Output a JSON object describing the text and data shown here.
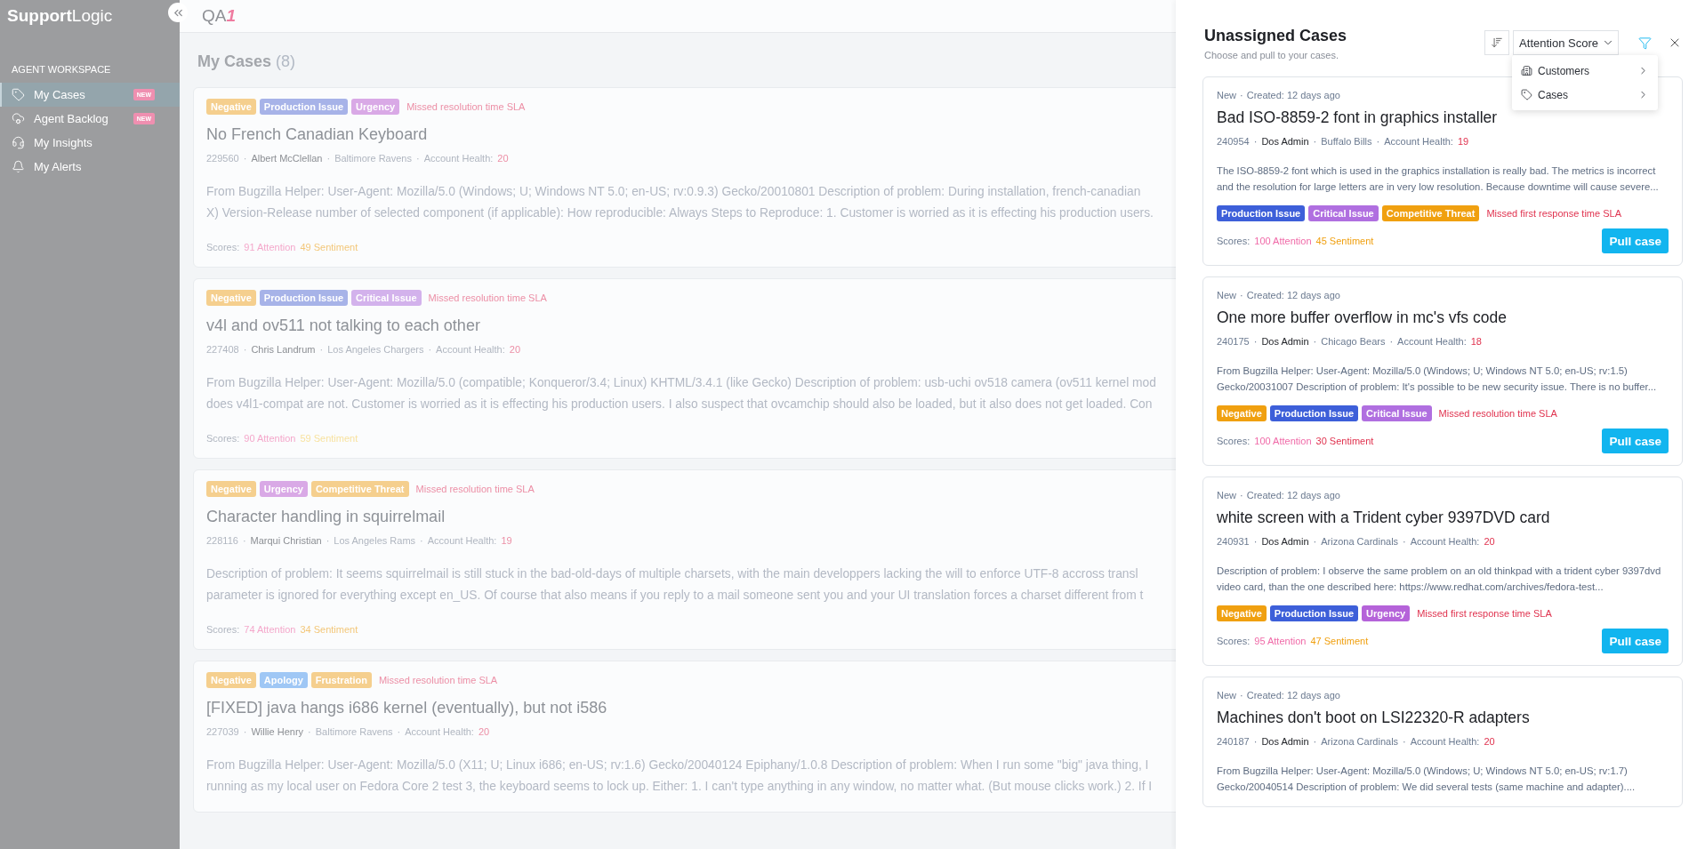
{
  "sidebar": {
    "logo": "**Support**Logic",
    "section_title": "AGENT WORKSPACE",
    "items": [
      {
        "label": "My Cases",
        "selected": true,
        "badge": "NEW"
      },
      {
        "label": "Agent Backlog",
        "selected": false,
        "badge": "NEW"
      },
      {
        "label": "My Insights",
        "selected": false
      },
      {
        "label": "My Alerts",
        "selected": false
      }
    ]
  },
  "header": {
    "workspace": "QA",
    "workspace_suffix": "1"
  },
  "main": {
    "title": "My Cases",
    "count": "(8)",
    "cases": [
      {
        "tags": [
          {
            "label": "Negative",
            "color": "#f5cf8e"
          },
          {
            "label": "Production Issue",
            "color": "#a7b3e8"
          },
          {
            "label": "Urgency",
            "color": "#d9a9e6"
          }
        ],
        "sla": "Missed resolution time SLA",
        "title": "No French Canadian Keyboard",
        "meta": [
          "229560",
          "·",
          "Albert McClellan",
          "·",
          "Baltimore Ravens",
          "·",
          "Account Health:",
          "20"
        ],
        "description_lines": [
          "From Bugzilla Helper: User-Agent: Mozilla/5.0 (Windows; U; Windows NT 5.0; en-US; rv:0.9.3) Gecko/20010801 Description of problem: During installation, french-canadian",
          "X) Version-Release number of selected component (if applicable): How reproducible: Always Steps to Reproduce: 1. Customer is worried as it is effecting his production users."
        ],
        "scores_label": "Scores:",
        "attention": "91 Attention",
        "sentiment": {
          "text": "49 Sentiment",
          "color": "#f3c77a"
        }
      },
      {
        "tags": [
          {
            "label": "Negative",
            "color": "#f5cf8e"
          },
          {
            "label": "Production Issue",
            "color": "#a7b3e8"
          },
          {
            "label": "Critical Issue",
            "color": "#d3b2ec"
          }
        ],
        "sla": "Missed resolution time SLA",
        "title": "v4l and ov511 not talking to each other",
        "meta": [
          "227408",
          "·",
          "Chris Landrum",
          "·",
          "Los Angeles Chargers",
          "·",
          "Account Health:",
          "20"
        ],
        "description_lines": [
          "From Bugzilla Helper: User-Agent: Mozilla/5.0 (compatible; Konqueror/3.4; Linux) KHTML/3.4.1 (like Gecko) Description of problem: usb-uchi ov518 camera (ov511 kernel mod",
          "does v4l1-compat are not. Customer is worried as it is effecting his production users. I also suspect that ovcamchip should also be loaded, but it also does not get loaded. Con"
        ],
        "scores_label": "Scores:",
        "attention": "90 Attention",
        "sentiment": {
          "text": "59 Sentiment",
          "color": "#f8e2a0"
        }
      },
      {
        "tags": [
          {
            "label": "Negative",
            "color": "#f5cf8e"
          },
          {
            "label": "Urgency",
            "color": "#d9a9e6"
          },
          {
            "label": "Competitive Threat",
            "color": "#f5cf8e"
          }
        ],
        "sla": "Missed resolution time SLA",
        "title": "Character handling in squirrelmail",
        "meta": [
          "228116",
          "·",
          "Marqui Christian",
          "·",
          "Los Angeles Rams",
          "·",
          "Account Health:",
          "19"
        ],
        "description_lines": [
          "Description of problem: It seems squirrelmail is still stuck in the bad-old-days of multiple charsets, with the main developpers lacking the will to enforce UTF-8 accross transl",
          "parameter is ignored for everything except en_US. Of course that also means if you reply to a mail someone sent you and your UI translation forces a charset different from t"
        ],
        "scores_label": "Scores:",
        "attention": "74 Attention",
        "sentiment": {
          "text": "34 Sentiment",
          "color": "#f3c77a"
        }
      },
      {
        "tags": [
          {
            "label": "Negative",
            "color": "#f5cf8e"
          },
          {
            "label": "Apology",
            "color": "#9fc7f5"
          },
          {
            "label": "Frustration",
            "color": "#f5cf8e"
          }
        ],
        "sla": "Missed resolution time SLA",
        "title": "[FIXED] java hangs i686 kernel (eventually), but not i586",
        "meta": [
          "227039",
          "·",
          "Willie Henry",
          "·",
          "Baltimore Ravens",
          "·",
          "Account Health:",
          "20"
        ],
        "description_lines": [
          "From Bugzilla Helper: User-Agent: Mozilla/5.0 (X11; U; Linux i686; en-US; rv:1.6) Gecko/20040124 Epiphany/1.0.8 Description of problem: When I run some \"big\" java thing, I",
          "running as my local user on Fedora Core 2 test 3, the keyboard seems to lock up. Either: 1. I can't type anything in any window, no matter what. (But mouse clicks work.) 2. If I"
        ]
      }
    ]
  },
  "panel": {
    "title": "Unassigned Cases",
    "subtitle": "Choose and pull to your cases.",
    "sort_field": "Attention Score",
    "menu": [
      {
        "label": "Customers"
      },
      {
        "label": "Cases"
      }
    ],
    "cards": [
      {
        "status": [
          "New",
          "·",
          "Created: 12 days ago"
        ],
        "title": "Bad ISO-8859-2 font in graphics installer",
        "meta": [
          "240954",
          "·",
          "Dos Admin",
          "·",
          "Buffalo Bills",
          "·",
          "Account Health:",
          "19"
        ],
        "description": "The ISO-8859-2 font which is used in the graphics installation is really bad. The metrics is incorrect and the resolution for large letters are in very low resolution. Because downtime will cause severe...",
        "tags": [
          {
            "label": "Production Issue",
            "color": "#3d5fd9"
          },
          {
            "label": "Critical Issue",
            "color": "#b06fe0"
          },
          {
            "label": "Competitive Threat",
            "color": "#f0a010"
          }
        ],
        "sla": "Missed first response time SLA",
        "scores_label": "Scores:",
        "attention": "100 Attention",
        "sentiment": {
          "text": "45 Sentiment",
          "color": "#f0a010"
        },
        "button": "Pull case"
      },
      {
        "status": [
          "New",
          "·",
          "Created: 12 days ago"
        ],
        "title": "One more buffer overflow in mc's vfs code",
        "meta": [
          "240175",
          "·",
          "Dos Admin",
          "·",
          "Chicago Bears",
          "·",
          "Account Health:",
          "18"
        ],
        "description": "From Bugzilla Helper: User-Agent: Mozilla/5.0 (Windows; U; Windows NT 5.0; en-US; rv:1.5) Gecko/20031007 Description of problem: It's possible to be new security issue. There is no buffer...",
        "tags": [
          {
            "label": "Negative",
            "color": "#f0a010"
          },
          {
            "label": "Production Issue",
            "color": "#3d5fd9"
          },
          {
            "label": "Critical Issue",
            "color": "#b06fe0"
          }
        ],
        "sla": "Missed resolution time SLA",
        "scores_label": "Scores:",
        "attention": "100 Attention",
        "sentiment": {
          "text": "30 Sentiment",
          "color": "#e0334f"
        },
        "button": "Pull case"
      },
      {
        "status": [
          "New",
          "·",
          "Created: 12 days ago"
        ],
        "title": "white screen with a Trident cyber 9397DVD card",
        "meta": [
          "240931",
          "·",
          "Dos Admin",
          "·",
          "Arizona Cardinals",
          "·",
          "Account Health:",
          "20"
        ],
        "description": "Description of problem: I observe the same problem on an old thinkpad with a trident cyber 9397dvd video card, than the one described here: https://www.redhat.com/archives/fedora-test...",
        "tags": [
          {
            "label": "Negative",
            "color": "#f0a010"
          },
          {
            "label": "Production Issue",
            "color": "#3d5fd9"
          },
          {
            "label": "Urgency",
            "color": "#b563d9"
          }
        ],
        "sla": "Missed first response time SLA",
        "scores_label": "Scores:",
        "attention": "95 Attention",
        "sentiment": {
          "text": "47 Sentiment",
          "color": "#f0a010"
        },
        "button": "Pull case"
      },
      {
        "status": [
          "New",
          "·",
          "Created: 12 days ago"
        ],
        "title": "Machines don't boot on LSI22320-R adapters",
        "meta": [
          "240187",
          "·",
          "Dos Admin",
          "·",
          "Arizona Cardinals",
          "·",
          "Account Health:",
          "20"
        ],
        "description": "From Bugzilla Helper: User-Agent: Mozilla/5.0 (Windows; U; Windows NT 5.0; en-US; rv:1.7) Gecko/20040514 Description of problem: We did several tests (same machine and adapter)...."
      }
    ]
  }
}
